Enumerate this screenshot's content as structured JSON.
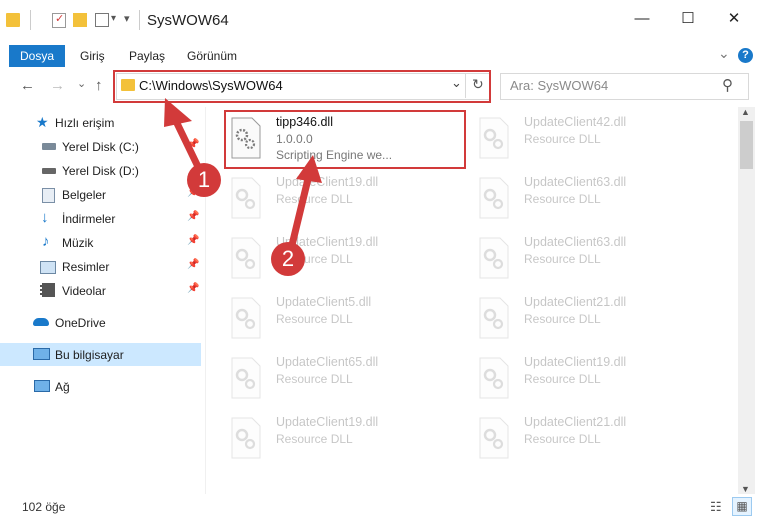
{
  "window": {
    "title": "SysWOW64",
    "minimize_glyph": "—",
    "maximize_glyph": "☐",
    "close_glyph": "✕"
  },
  "ribbon": {
    "tabs": [
      "Dosya",
      "Giriş",
      "Paylaş",
      "Görünüm"
    ],
    "collapse_glyph": "⌄",
    "help_glyph": "?"
  },
  "navigation": {
    "back_glyph": "←",
    "forward_glyph": "→",
    "recent_glyph": "⌄",
    "up_glyph": "↑",
    "address": "C:\\Windows\\SysWOW64",
    "address_dropdown_glyph": "⌄",
    "refresh_glyph": "↻",
    "search_placeholder": "Ara: SysWOW64",
    "search_glyph": "⚲"
  },
  "sidebar": {
    "items": [
      {
        "label": "Hızlı erişim",
        "icon": "star-icon"
      },
      {
        "label": "Yerel Disk (C:)",
        "icon": "drive-icon"
      },
      {
        "label": "Yerel Disk (D:)",
        "icon": "drive-icon"
      },
      {
        "label": "Belgeler",
        "icon": "documents-icon"
      },
      {
        "label": "İndirmeler",
        "icon": "download-icon"
      },
      {
        "label": "Müzik",
        "icon": "music-icon"
      },
      {
        "label": "Resimler",
        "icon": "pictures-icon"
      },
      {
        "label": "Videolar",
        "icon": "video-icon"
      },
      {
        "label": "OneDrive",
        "icon": "cloud-icon"
      },
      {
        "label": "Bu bilgisayar",
        "icon": "computer-icon"
      },
      {
        "label": "Ağ",
        "icon": "network-icon"
      }
    ],
    "pin_glyph": "📌"
  },
  "files": {
    "highlighted": {
      "name": "tipp346.dll",
      "version": "1.0.0.0",
      "description": "Scripting Engine we..."
    },
    "left_column": [
      {
        "name": "UpdateClient19.dll",
        "description": "Resource DLL"
      },
      {
        "name": "UpdateClient19.dll",
        "description": "Resource DLL"
      },
      {
        "name": "UpdateClient5.dll",
        "description": "Resource DLL"
      },
      {
        "name": "UpdateClient65.dll",
        "description": "Resource DLL"
      },
      {
        "name": "UpdateClient19.dll",
        "description": "Resource DLL"
      }
    ],
    "right_column": [
      {
        "name": "UpdateClient42.dll",
        "description": "Resource DLL"
      },
      {
        "name": "UpdateClient63.dll",
        "description": "Resource DLL"
      },
      {
        "name": "UpdateClient63.dll",
        "description": "Resource DLL"
      },
      {
        "name": "UpdateClient21.dll",
        "description": "Resource DLL"
      },
      {
        "name": "UpdateClient19.dll",
        "description": "Resource DLL"
      },
      {
        "name": "UpdateClient21.dll",
        "description": "Resource DLL"
      }
    ]
  },
  "status": {
    "count": "102 öğe",
    "details_view_glyph": "☷",
    "tiles_view_glyph": "▦"
  },
  "annotations": {
    "step1": "1",
    "step2": "2",
    "color": "#d23a3a"
  },
  "colors": {
    "accent": "#1979ca",
    "selection": "#cce8ff"
  }
}
